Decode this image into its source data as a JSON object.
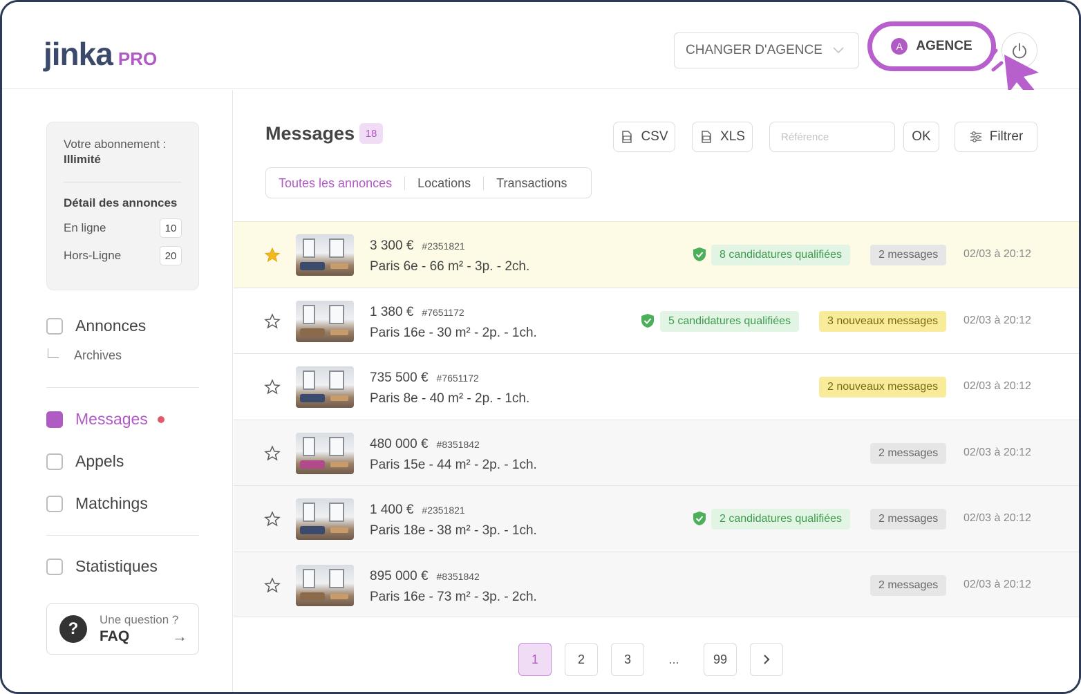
{
  "header": {
    "logo_brand": "jinka",
    "logo_suffix": "PRO",
    "agency_select": "CHANGER D'AGENCE",
    "agency_avatar": "A",
    "agency_button": "AGENCE"
  },
  "sidebar": {
    "subscription_label": "Votre abonnement :",
    "subscription_value": "Illimité",
    "detail_title": "Détail des annonces",
    "online_label": "En ligne",
    "online_count": "10",
    "offline_label": "Hors-Ligne",
    "offline_count": "20",
    "nav": {
      "annonces": "Annonces",
      "archives": "Archives",
      "messages": "Messages",
      "appels": "Appels",
      "matchings": "Matchings",
      "statistiques": "Statistiques"
    },
    "faq_question": "Une question ?",
    "faq_label": "FAQ"
  },
  "main": {
    "title": "Messages",
    "title_count": "18",
    "csv_label": "CSV",
    "xls_label": "XLS",
    "reference_placeholder": "Référence",
    "ok_label": "OK",
    "filter_label": "Filtrer",
    "tabs": [
      "Toutes les annonces",
      "Locations",
      "Transactions"
    ]
  },
  "listings": [
    {
      "price": "3 300 €",
      "ref": "#2351821",
      "location": "Paris 6e - 66 m² - 3p. - 2ch.",
      "qualified": "8 candidatures qualifiées",
      "messages": "2 messages",
      "messages_type": "grey",
      "date": "02/03 à 20:12",
      "favorite": true
    },
    {
      "price": "1 380 €",
      "ref": "#7651172",
      "location": "Paris 16e - 30 m² - 2p. - 1ch.",
      "qualified": "5 candidatures qualifiées",
      "messages": "3 nouveaux messages",
      "messages_type": "yellow",
      "date": "02/03 à 20:12",
      "favorite": false
    },
    {
      "price": "735 500 €",
      "ref": "#7651172",
      "location": "Paris 8e - 40 m² - 2p. - 1ch.",
      "qualified": "",
      "messages": "2 nouveaux messages",
      "messages_type": "yellow",
      "date": "02/03 à 20:12",
      "favorite": false
    },
    {
      "price": "480 000 €",
      "ref": "#8351842",
      "location": "Paris 15e - 44 m² - 2p. - 1ch.",
      "qualified": "",
      "messages": "2 messages",
      "messages_type": "grey",
      "date": "02/03 à 20:12",
      "favorite": false
    },
    {
      "price": "1 400 €",
      "ref": "#2351821",
      "location": "Paris 18e - 38 m² - 3p. - 1ch.",
      "qualified": "2 candidatures qualifiées",
      "messages": "2 messages",
      "messages_type": "grey",
      "date": "02/03 à 20:12",
      "favorite": false
    },
    {
      "price": "895 000 €",
      "ref": "#8351842",
      "location": "Paris 16e - 73 m² - 3p. - 2ch.",
      "qualified": "",
      "messages": "2 messages",
      "messages_type": "grey",
      "date": "02/03 à 20:12",
      "favorite": false
    }
  ],
  "pagination": {
    "pages": [
      "1",
      "2",
      "3"
    ],
    "ellipsis": "...",
    "last": "99",
    "next_icon": "chevron-right-icon"
  },
  "colors": {
    "accent": "#b05ac4",
    "brand_dark": "#3b4a6b",
    "highlight_row": "#fdfae6",
    "qualified_green": "#3e9a4c"
  },
  "icons": [
    "power-icon",
    "cursor-pointer-icon",
    "star-icon",
    "shield-check-icon",
    "file-csv-icon",
    "file-xls-icon",
    "filter-sliders-icon",
    "question-icon",
    "arrow-right-icon",
    "chevron-down-icon"
  ]
}
